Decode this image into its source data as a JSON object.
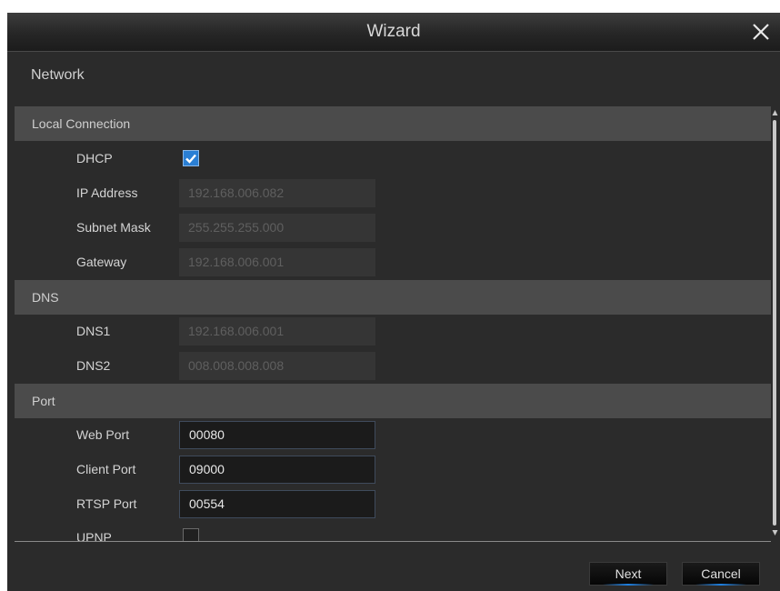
{
  "window": {
    "title": "Wizard",
    "close_icon": "close-icon"
  },
  "section": {
    "heading": "Network"
  },
  "groups": {
    "local_connection": "Local Connection",
    "dns": "DNS",
    "port": "Port"
  },
  "fields": {
    "dhcp": {
      "label": "DHCP",
      "checked": true
    },
    "ip_address": {
      "label": "IP Address",
      "value": "192.168.006.082"
    },
    "subnet_mask": {
      "label": "Subnet Mask",
      "value": "255.255.255.000"
    },
    "gateway": {
      "label": "Gateway",
      "value": "192.168.006.001"
    },
    "dns1": {
      "label": "DNS1",
      "value": "192.168.006.001"
    },
    "dns2": {
      "label": "DNS2",
      "value": "008.008.008.008"
    },
    "web_port": {
      "label": "Web Port",
      "value": "00080"
    },
    "client_port": {
      "label": "Client Port",
      "value": "09000"
    },
    "rtsp_port": {
      "label": "RTSP Port",
      "value": "00554"
    },
    "upnp": {
      "label": "UPNP",
      "checked": false
    }
  },
  "buttons": {
    "next": "Next",
    "cancel": "Cancel"
  },
  "colors": {
    "background": "#2b2b2b",
    "group_header": "#4b4b4b",
    "accent": "#2a7fd4"
  }
}
